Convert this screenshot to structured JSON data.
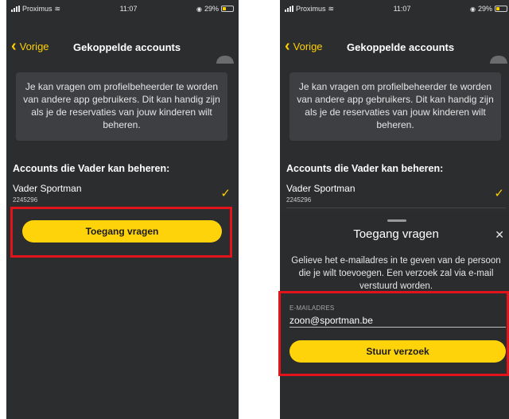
{
  "status_bar": {
    "carrier": "Proximus",
    "time": "11:07",
    "battery": "29%"
  },
  "nav": {
    "back_label": "Vorige",
    "title": "Gekoppelde accounts"
  },
  "info_text": "Je kan vragen om profielbeheerder te worden van andere app gebruikers. Dit kan handig zijn als je de reservaties van jouw kinderen wilt beheren.",
  "accounts": {
    "heading": "Accounts die Vader kan beheren:",
    "items": [
      {
        "name": "Vader Sportman",
        "id": "2245296"
      }
    ]
  },
  "request_button_label": "Toegang vragen",
  "sheet": {
    "title": "Toegang vragen",
    "description": "Gelieve het e-mailadres in te geven van de persoon die je wilt toevoegen. Een verzoek zal via e-mail verstuurd worden.",
    "email_label": "E-MAILADRES",
    "email_value": "zoon@sportman.be",
    "send_label": "Stuur verzoek"
  },
  "colors": {
    "accent": "#ffd30a",
    "background": "#2b2d2f",
    "highlight": "#e3131b"
  },
  "icons": [
    "chevron-left-icon",
    "check-icon",
    "close-icon",
    "wifi-icon",
    "battery-icon"
  ]
}
